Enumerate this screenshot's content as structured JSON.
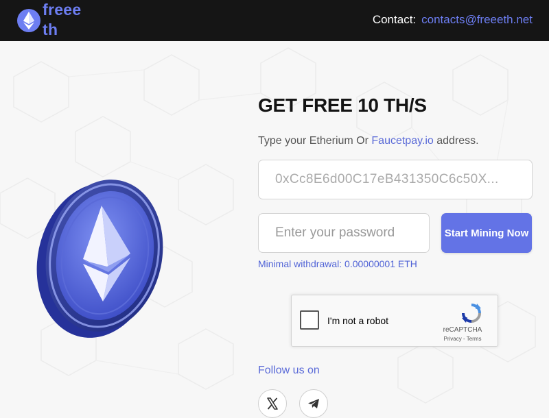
{
  "header": {
    "logo_text": "freee\nth",
    "logo_icon": "ethereum-icon",
    "contact_label": "Contact:",
    "contact_email": "contacts@freeeth.net"
  },
  "hero": {
    "coin_icon": "ethereum-coin"
  },
  "form": {
    "title": "GET FREE 10 TH/S",
    "subtitle_prefix": "Type your Etherium Or ",
    "subtitle_link": "Faucetpay.io",
    "subtitle_suffix": " address.",
    "address_placeholder": "0xCc8E6d00C17eB431350C6c50X...",
    "password_placeholder": "Enter your password",
    "mine_button": "Start Mining Now",
    "min_withdrawal": "Minimal withdrawal: 0.00000001 ETH"
  },
  "captcha": {
    "label": "I'm not a robot",
    "brand": "reCAPTCHA",
    "privacy": "Privacy",
    "separator": " - ",
    "terms": "Terms",
    "checked": false
  },
  "social": {
    "follow_label": "Follow us on",
    "links": [
      {
        "icon": "x-twitter-icon"
      },
      {
        "icon": "telegram-icon"
      }
    ]
  },
  "colors": {
    "accent": "#6373e6",
    "link": "#5b6bd8",
    "header_bg": "#151515",
    "page_bg": "#f7f7f7"
  }
}
